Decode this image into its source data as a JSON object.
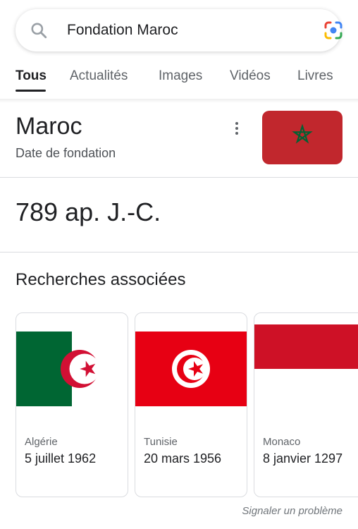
{
  "search": {
    "query": "Fondation Maroc"
  },
  "tabs": [
    {
      "label": "Tous"
    },
    {
      "label": "Actualités"
    },
    {
      "label": "Images"
    },
    {
      "label": "Vidéos"
    },
    {
      "label": "Livres"
    }
  ],
  "knowledge_panel": {
    "title": "Maroc",
    "subtitle": "Date de fondation",
    "answer": "789 ap. J.-C."
  },
  "related": {
    "title": "Recherches associées",
    "items": [
      {
        "country": "Algérie",
        "date": "5 juillet 1962"
      },
      {
        "country": "Tunisie",
        "date": "20 mars 1956"
      },
      {
        "country": "Monaco",
        "date": "8 janvier 1297"
      }
    ]
  },
  "footer": {
    "report": "Signaler un problème"
  },
  "colors": {
    "morocco_red": "#c1272d",
    "morocco_green": "#006233",
    "algeria_green": "#006633",
    "algeria_red": "#d21034",
    "tunisia_red": "#e70013",
    "monaco_red": "#ce1126"
  }
}
